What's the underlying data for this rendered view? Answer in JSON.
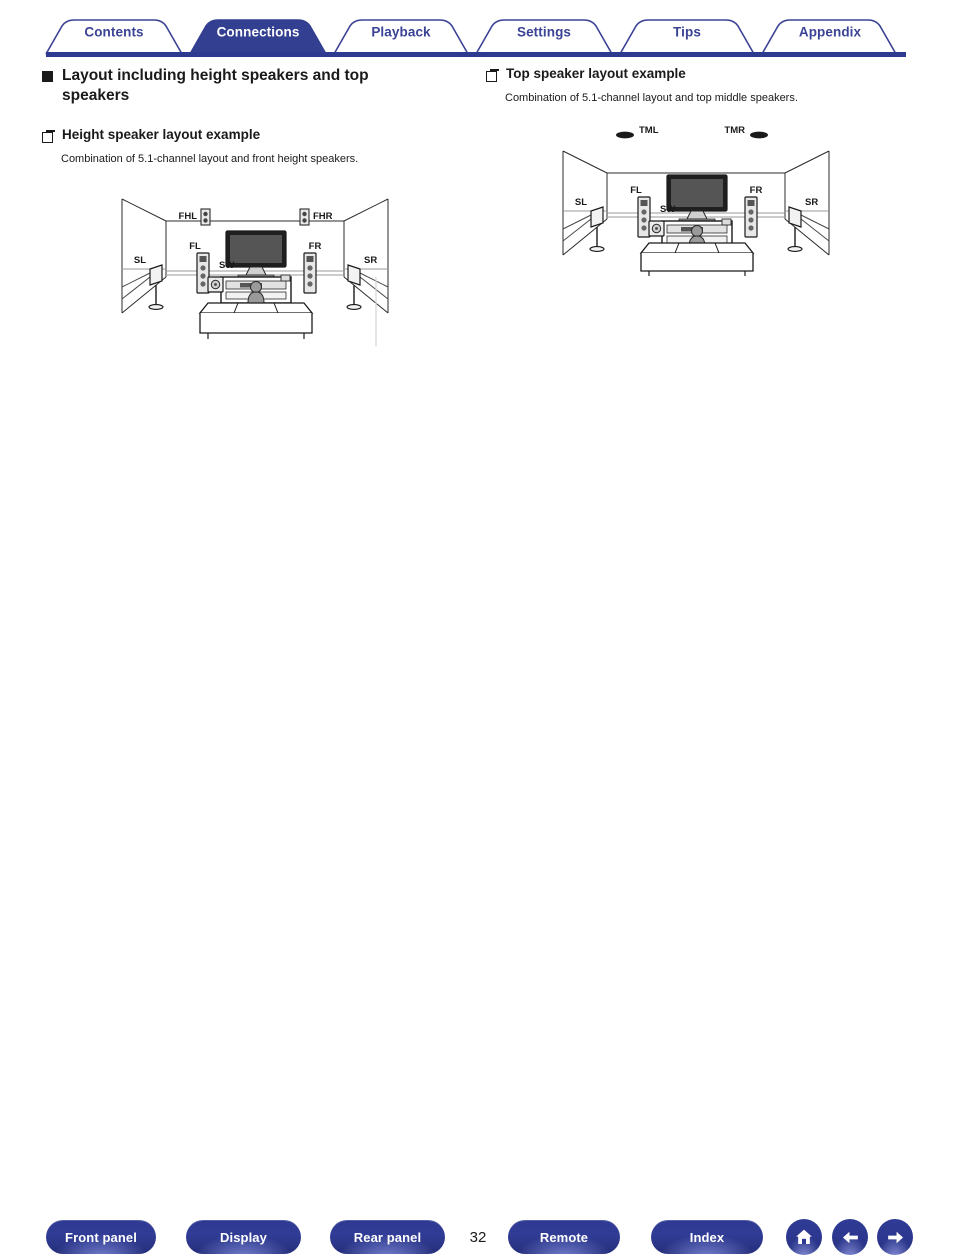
{
  "tabs": [
    {
      "label": "Contents",
      "active": false
    },
    {
      "label": "Connections",
      "active": true
    },
    {
      "label": "Playback",
      "active": false
    },
    {
      "label": "Settings",
      "active": false
    },
    {
      "label": "Tips",
      "active": false
    },
    {
      "label": "Appendix",
      "active": false
    }
  ],
  "colors": {
    "brand_navy": "#3b4396",
    "tab_active_fill": "#333f91",
    "tab_text": "#3b4396",
    "tab_active_text": "#ffffff",
    "rule": "#2e3a8f",
    "body_text": "#1a1a1a"
  },
  "left_column": {
    "heading": "Layout including height speakers and top speakers",
    "subheading": "Height speaker layout example",
    "description": "Combination of 5.1-channel layout and front height speakers.",
    "diagram": {
      "name": "height-speaker-layout-diagram",
      "speaker_labels": [
        "FHL",
        "FHR",
        "FL",
        "FR",
        "SL",
        "SR",
        "SW"
      ]
    }
  },
  "right_column": {
    "subheading": "Top speaker layout example",
    "description": "Combination of 5.1-channel layout and top middle speakers.",
    "diagram": {
      "name": "top-speaker-layout-diagram",
      "speaker_labels": [
        "TML",
        "TMR",
        "FL",
        "FR",
        "SL",
        "SR",
        "SW"
      ]
    }
  },
  "footer": {
    "buttons": [
      {
        "label": "Front panel"
      },
      {
        "label": "Display"
      },
      {
        "label": "Rear panel"
      },
      {
        "label": "Remote"
      },
      {
        "label": "Index"
      }
    ],
    "page_number": "32",
    "icons": [
      {
        "name": "home-icon"
      },
      {
        "name": "arrow-left-icon"
      },
      {
        "name": "arrow-right-icon"
      }
    ]
  }
}
